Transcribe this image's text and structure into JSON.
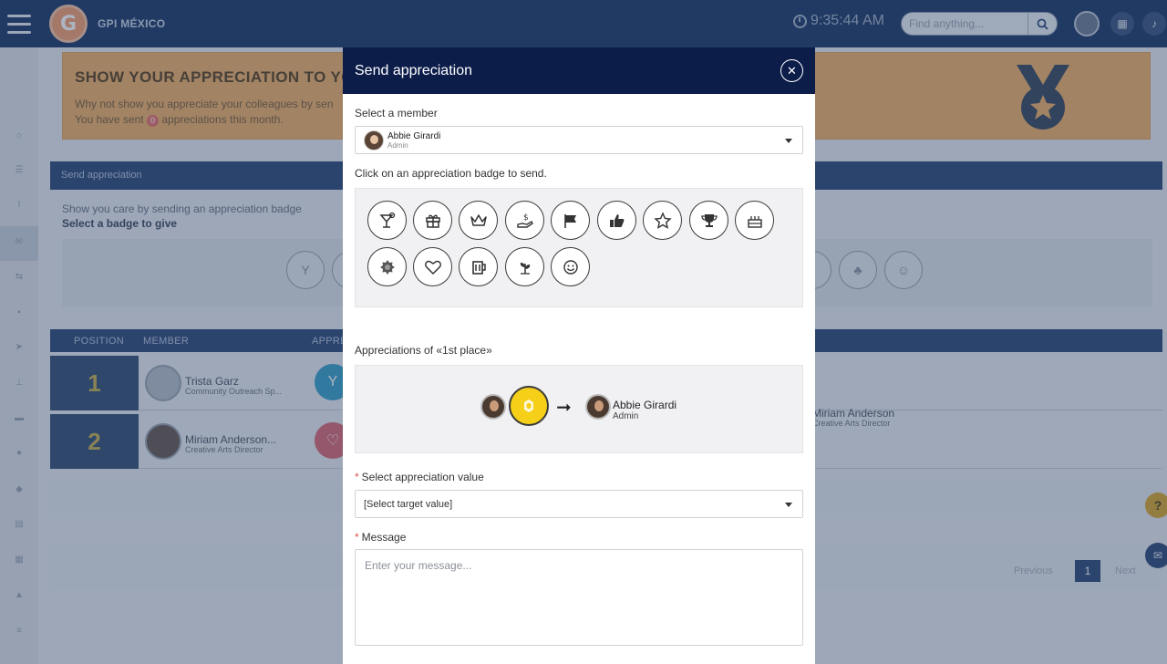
{
  "topbar": {
    "org_name": "GPI MÉXICO",
    "logo_letter": "G",
    "time": "9:35:44 AM",
    "search_placeholder": "Find anything..."
  },
  "banner": {
    "title": "SHOW YOUR APPRECIATION TO YO",
    "line1": "Why not show you appreciate your colleagues by sen",
    "line2_prefix": "You have sent",
    "line2_count": "0",
    "line2_suffix": "appreciations this month."
  },
  "send_card": {
    "header": "Send appreciation",
    "text1": "Show you care by sending an appreciation badge",
    "text2": "Select a badge to give"
  },
  "table": {
    "headers": [
      "POSITION",
      "MEMBER",
      "APPRE"
    ],
    "rows": [
      {
        "position": "1",
        "name": "Trista Garz",
        "role": "Community Outreach Sp...",
        "badge_color": "#3aa0c9",
        "badge_icon": "cocktail-icon",
        "extra_name": "",
        "extra_role": ""
      },
      {
        "position": "2",
        "name": "Miriam Anderson...",
        "role": "Creative Arts Director",
        "badge_color": "#d86a75",
        "badge_icon": "heart-icon",
        "extra_name": "Miriam Anderson",
        "extra_role": "Creative Arts Director"
      }
    ]
  },
  "pagination": {
    "prev": "Previous",
    "current": "1",
    "next": "Next"
  },
  "modal": {
    "title": "Send appreciation",
    "close_symbol": "✕",
    "member_label": "Select a member",
    "member_name": "Abbie Girardi",
    "member_role": "Admin",
    "badge_instruction": "Click on an appreciation badge to send.",
    "badges_row1": [
      "cocktail-icon",
      "gift-icon",
      "crown-icon",
      "money-hand-icon",
      "flag-icon",
      "thumbs-up-icon",
      "star-icon",
      "trophy-icon",
      "cake-icon"
    ],
    "badges_row2": [
      "sun-icon",
      "heart-icon",
      "beer-icon",
      "sprout-icon",
      "smiley-icon"
    ],
    "preview_label": "Appreciations of «1st place»",
    "preview_recipient_name": "Abbie Girardi",
    "preview_recipient_role": "Admin",
    "value_label": "Select appreciation value",
    "value_select": "[Select target value]",
    "message_label": "Message",
    "message_placeholder": "Enter your message..."
  },
  "colors": {
    "topbar": "#1f3a68",
    "modal_header": "#0c1d4a",
    "banner": "#efb16a",
    "preview_badge": "#f5cf18"
  }
}
